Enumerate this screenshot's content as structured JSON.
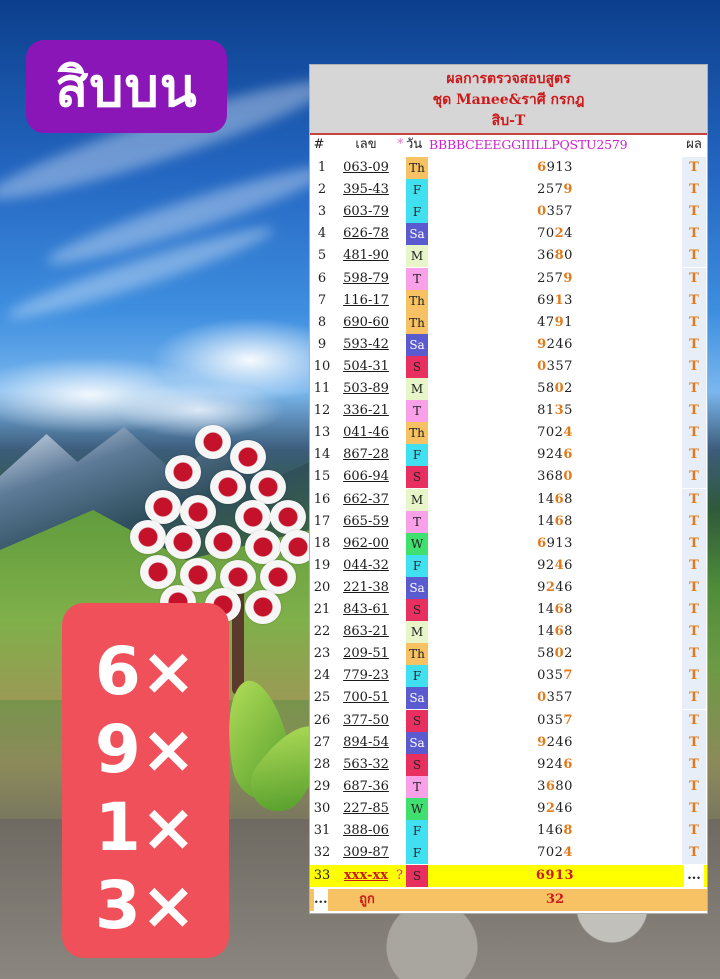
{
  "badge": {
    "title": "สิบบน"
  },
  "results": [
    "6×",
    "9×",
    "1×",
    "3×"
  ],
  "panel": {
    "heading1": "ผลการตรวจสอบสูตร",
    "heading2": "ชุด Manee&ราศี กรกฎ",
    "heading3": "สิบ-T",
    "col_num": "#",
    "col_no": "เลข",
    "col_star": "*",
    "col_day": "วัน",
    "col_seq": "BBBBCEEEGGIIILLPQSTU2579",
    "col_res": "ผล",
    "day_colors": {
      "Th": "#f7c264",
      "F": "#40e0f0",
      "Sa": "#5b5bd0",
      "M": "#e8f5c8",
      "T": "#f8a0e8",
      "S": "#e83060",
      "W": "#40e070"
    },
    "rows": [
      {
        "n": "1",
        "no": "063-09",
        "day": "Th",
        "seq_pre": "",
        "seq_hl": "6",
        "seq_post": "913",
        "res": "T"
      },
      {
        "n": "2",
        "no": "395-43",
        "day": "F",
        "seq_pre": "257",
        "seq_hl": "9",
        "seq_post": "",
        "res": "T"
      },
      {
        "n": "3",
        "no": "603-79",
        "day": "F",
        "seq_pre": "",
        "seq_hl": "0",
        "seq_post": "357",
        "res": "T"
      },
      {
        "n": "4",
        "no": "626-78",
        "day": "Sa",
        "seq_pre": "70",
        "seq_hl": "2",
        "seq_post": "4",
        "res": "T"
      },
      {
        "n": "5",
        "no": "481-90",
        "day": "M",
        "seq_pre": "36",
        "seq_hl": "8",
        "seq_post": "0",
        "res": "T"
      },
      {
        "n": "6",
        "no": "598-79",
        "day": "T",
        "seq_pre": "257",
        "seq_hl": "9",
        "seq_post": "",
        "res": "T"
      },
      {
        "n": "7",
        "no": "116-17",
        "day": "Th",
        "seq_pre": "69",
        "seq_hl": "1",
        "seq_post": "3",
        "res": "T"
      },
      {
        "n": "8",
        "no": "690-60",
        "day": "Th",
        "seq_pre": "47",
        "seq_hl": "9",
        "seq_post": "1",
        "res": "T"
      },
      {
        "n": "9",
        "no": "593-42",
        "day": "Sa",
        "seq_pre": "",
        "seq_hl": "9",
        "seq_post": "246",
        "res": "T"
      },
      {
        "n": "10",
        "no": "504-31",
        "day": "S",
        "seq_pre": "",
        "seq_hl": "0",
        "seq_post": "357",
        "res": "T"
      },
      {
        "n": "11",
        "no": "503-89",
        "day": "M",
        "seq_pre": "58",
        "seq_hl": "0",
        "seq_post": "2",
        "res": "T"
      },
      {
        "n": "12",
        "no": "336-21",
        "day": "T",
        "seq_pre": "81",
        "seq_hl": "3",
        "seq_post": "5",
        "res": "T"
      },
      {
        "n": "13",
        "no": "041-46",
        "day": "Th",
        "seq_pre": "702",
        "seq_hl": "4",
        "seq_post": "",
        "res": "T"
      },
      {
        "n": "14",
        "no": "867-28",
        "day": "F",
        "seq_pre": "924",
        "seq_hl": "6",
        "seq_post": "",
        "res": "T"
      },
      {
        "n": "15",
        "no": "606-94",
        "day": "S",
        "seq_pre": "368",
        "seq_hl": "0",
        "seq_post": "",
        "res": "T"
      },
      {
        "n": "16",
        "no": "662-37",
        "day": "M",
        "seq_pre": "14",
        "seq_hl": "6",
        "seq_post": "8",
        "res": "T"
      },
      {
        "n": "17",
        "no": "665-59",
        "day": "T",
        "seq_pre": "14",
        "seq_hl": "6",
        "seq_post": "8",
        "res": "T"
      },
      {
        "n": "18",
        "no": "962-00",
        "day": "W",
        "seq_pre": "",
        "seq_hl": "6",
        "seq_post": "913",
        "res": "T"
      },
      {
        "n": "19",
        "no": "044-32",
        "day": "F",
        "seq_pre": "92",
        "seq_hl": "4",
        "seq_post": "6",
        "res": "T"
      },
      {
        "n": "20",
        "no": "221-38",
        "day": "Sa",
        "seq_pre": "9",
        "seq_hl": "2",
        "seq_post": "46",
        "res": "T"
      },
      {
        "n": "21",
        "no": "843-61",
        "day": "S",
        "seq_pre": "14",
        "seq_hl": "6",
        "seq_post": "8",
        "res": "T"
      },
      {
        "n": "22",
        "no": "863-21",
        "day": "M",
        "seq_pre": "14",
        "seq_hl": "6",
        "seq_post": "8",
        "res": "T"
      },
      {
        "n": "23",
        "no": "209-51",
        "day": "Th",
        "seq_pre": "58",
        "seq_hl": "0",
        "seq_post": "2",
        "res": "T"
      },
      {
        "n": "24",
        "no": "779-23",
        "day": "F",
        "seq_pre": "035",
        "seq_hl": "7",
        "seq_post": "",
        "res": "T"
      },
      {
        "n": "25",
        "no": "700-51",
        "day": "Sa",
        "seq_pre": "",
        "seq_hl": "0",
        "seq_post": "357",
        "res": "T"
      },
      {
        "n": "26",
        "no": "377-50",
        "day": "S",
        "seq_pre": "035",
        "seq_hl": "7",
        "seq_post": "",
        "res": "T"
      },
      {
        "n": "27",
        "no": "894-54",
        "day": "Sa",
        "seq_pre": "",
        "seq_hl": "9",
        "seq_post": "246",
        "res": "T"
      },
      {
        "n": "28",
        "no": "563-32",
        "day": "S",
        "seq_pre": "924",
        "seq_hl": "6",
        "seq_post": "",
        "res": "T"
      },
      {
        "n": "29",
        "no": "687-36",
        "day": "T",
        "seq_pre": "3",
        "seq_hl": "6",
        "seq_post": "80",
        "res": "T"
      },
      {
        "n": "30",
        "no": "227-85",
        "day": "W",
        "seq_pre": "9",
        "seq_hl": "2",
        "seq_post": "46",
        "res": "T"
      },
      {
        "n": "31",
        "no": "388-06",
        "day": "F",
        "seq_pre": "146",
        "seq_hl": "8",
        "seq_post": "",
        "res": "T"
      },
      {
        "n": "32",
        "no": "309-87",
        "day": "F",
        "seq_pre": "702",
        "seq_hl": "4",
        "seq_post": "",
        "res": "T"
      }
    ],
    "last_row": {
      "n": "33",
      "no": "xxx-xx",
      "mark": "?",
      "day": "S",
      "seq": "6913",
      "res": "..."
    },
    "footer": {
      "dots": "...",
      "label": "ถูก",
      "count": "32"
    }
  }
}
